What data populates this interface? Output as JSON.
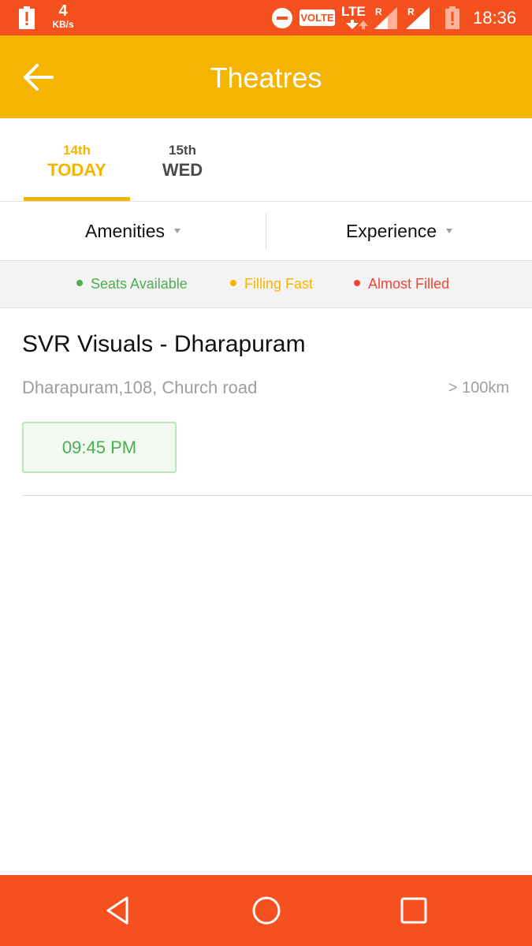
{
  "status_bar": {
    "network_speed_value": "4",
    "network_speed_unit": "KB/s",
    "volte": "VOLTE",
    "lte": "LTE",
    "roaming_1": "R",
    "roaming_2": "R",
    "time": "18:36",
    "icons": [
      "battery-alert-icon",
      "do-not-disturb-icon",
      "lte-data-arrows-icon",
      "signal-icon",
      "battery-icon"
    ]
  },
  "app_bar": {
    "title": "Theatres",
    "back_icon": "arrow-left-icon"
  },
  "date_tabs": [
    {
      "day": "14th",
      "label": "TODAY",
      "active": true
    },
    {
      "day": "15th",
      "label": "WED",
      "active": false
    }
  ],
  "filters": {
    "amenities": "Amenities",
    "experience": "Experience"
  },
  "legend": {
    "seats_available": "Seats Available",
    "filling_fast": "Filling Fast",
    "almost_filled": "Almost Filled"
  },
  "theatre": {
    "name": "SVR Visuals - Dharapuram",
    "address": "Dharapuram,108, Church road",
    "distance": "> 100km",
    "showtimes": [
      "09:45 PM"
    ]
  },
  "colors": {
    "status_bar": "#f4511e",
    "app_bar": "#f5b400",
    "accent": "#f5b400",
    "available": "#4caf50",
    "filling": "#f5b400",
    "almost_filled": "#f44336",
    "nav_bar": "#f4511e"
  },
  "nav_bar": {
    "icons": [
      "nav-back-icon",
      "nav-home-icon",
      "nav-recents-icon"
    ]
  }
}
